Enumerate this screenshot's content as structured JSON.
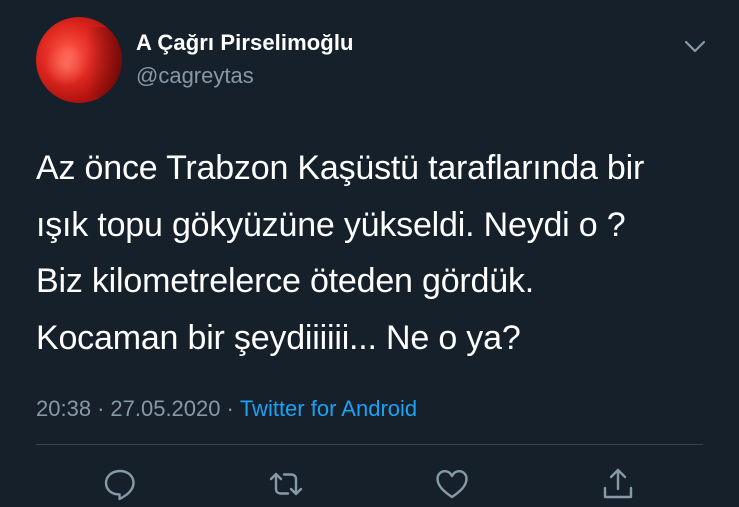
{
  "tweet": {
    "author": {
      "display_name": "A Çağrı Pirselimoğlu",
      "handle": "@cagreytas"
    },
    "text_lines": [
      "Az önce Trabzon Kaşüstü taraflarında bir",
      "ışık topu gökyüzüne yükseldi. Neydi o ?",
      "Biz kilometrelerce öteden gördük.",
      "Kocaman bir şeydiiiiii... Ne o ya?"
    ],
    "time": "20:38",
    "date": "27.05.2020",
    "separator": "·",
    "source": "Twitter for Android"
  },
  "actions": {
    "reply_icon": "speech-bubble-icon",
    "retweet_icon": "retweet-arrows-icon",
    "like_icon": "heart-icon",
    "share_icon": "share-upload-icon"
  },
  "colors": {
    "background": "#15202b",
    "text_primary": "#ffffff",
    "text_secondary": "#8899a6",
    "link": "#1da1f2",
    "divider": "#38444d"
  }
}
